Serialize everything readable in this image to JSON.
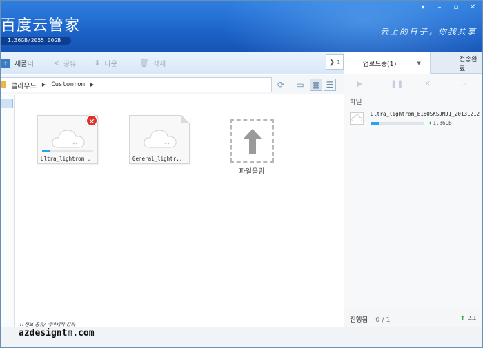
{
  "app": {
    "title": "百度云管家",
    "storage": "1.36GB/2055.00GB",
    "slogan": "云上的日子，你我共享"
  },
  "window_controls": {
    "menu": "▾",
    "minimize": "–",
    "restore": "▫",
    "close": "✕"
  },
  "toolbar": {
    "new_folder": "새폴더",
    "share": "공유",
    "download": "다운",
    "delete": "삭제",
    "collapse_count": "1"
  },
  "path": {
    "root": "클라우드",
    "current": "Customrom"
  },
  "files": [
    {
      "name": "Ultra_lightrom...",
      "status": "error",
      "progress": 0.15
    },
    {
      "name": "General_lightr...",
      "status": "done"
    }
  ],
  "upload_tile": {
    "label": "파일올림"
  },
  "right_panel": {
    "tab_uploading": "업로드중(1)",
    "tab_complete": "전송완료",
    "list_header": "파일",
    "item": {
      "name": "Ultra_lightrom_E160SKSJMJ1_20131212",
      "size": "1.36GB",
      "progress": 0.15
    },
    "footer_label": "진행됨",
    "footer_count": "0 / 1",
    "footer_speed": "2.1"
  },
  "watermark": {
    "tagline": "IT정보 공유/ 테마제작 강좌",
    "site": "azdesigntm.com"
  },
  "colors": {
    "titlebar": "#1c63c8",
    "accent": "#2aa4e8",
    "error": "#e0302c",
    "upload_green": "#2aa04a"
  }
}
